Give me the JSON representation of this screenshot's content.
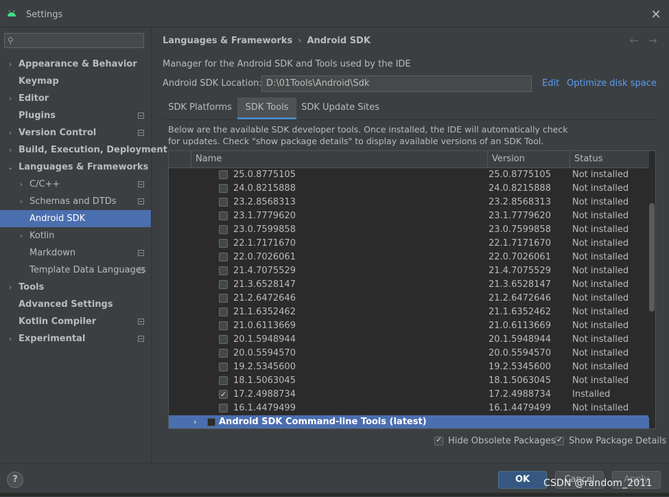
{
  "window": {
    "title": "Settings",
    "close_glyph": "✕"
  },
  "search": {
    "placeholder": ""
  },
  "sidebar": {
    "items": [
      {
        "label": "Appearance & Behavior",
        "chevron": "›",
        "bold": true,
        "indent": 0
      },
      {
        "label": "Keymap",
        "bold": true,
        "indent": 0
      },
      {
        "label": "Editor",
        "chevron": "›",
        "bold": true,
        "indent": 0
      },
      {
        "label": "Plugins",
        "bold": true,
        "indent": 0,
        "project": true
      },
      {
        "label": "Version Control",
        "chevron": "›",
        "bold": true,
        "indent": 0,
        "project": true
      },
      {
        "label": "Build, Execution, Deployment",
        "chevron": "›",
        "bold": true,
        "indent": 0
      },
      {
        "label": "Languages & Frameworks",
        "chevron": "⌄",
        "bold": true,
        "indent": 0
      },
      {
        "label": "C/C++",
        "chevron": "›",
        "indent": 1,
        "project": true
      },
      {
        "label": "Schemas and DTDs",
        "chevron": "›",
        "indent": 1,
        "project": true
      },
      {
        "label": "Android SDK",
        "indent": 1,
        "selected": true
      },
      {
        "label": "Kotlin",
        "chevron": "›",
        "indent": 1
      },
      {
        "label": "Markdown",
        "indent": 1,
        "project": true
      },
      {
        "label": "Template Data Languages",
        "indent": 1,
        "project": true
      },
      {
        "label": "Tools",
        "chevron": "›",
        "bold": true,
        "indent": 0
      },
      {
        "label": "Advanced Settings",
        "bold": true,
        "indent": 0
      },
      {
        "label": "Kotlin Compiler",
        "bold": true,
        "indent": 0,
        "project": true
      },
      {
        "label": "Experimental",
        "chevron": "›",
        "bold": true,
        "indent": 0,
        "project": true
      }
    ]
  },
  "breadcrumb": {
    "parent": "Languages & Frameworks",
    "separator": "›",
    "current": "Android SDK"
  },
  "nav": {
    "back": "←",
    "forward": "→"
  },
  "description": "Manager for the Android SDK and Tools used by the IDE",
  "sdk_location": {
    "label": "Android SDK Location:",
    "value": "D:\\01Tools\\Android\\Sdk",
    "edit": "Edit",
    "optimize": "Optimize disk space"
  },
  "tabs": [
    {
      "label": "SDK Platforms",
      "active": false
    },
    {
      "label": "SDK Tools",
      "active": true
    },
    {
      "label": "SDK Update Sites",
      "active": false
    }
  ],
  "panel_description": "Below are the available SDK developer tools. Once installed, the IDE will automatically check for updates. Check \"show package details\" to display available versions of an SDK Tool.",
  "table": {
    "columns": [
      "Name",
      "Version",
      "Status"
    ],
    "rows": [
      {
        "name": "25.0.8775105",
        "version": "25.0.8775105",
        "status": "Not installed",
        "checked": false
      },
      {
        "name": "24.0.8215888",
        "version": "24.0.8215888",
        "status": "Not installed",
        "checked": false
      },
      {
        "name": "23.2.8568313",
        "version": "23.2.8568313",
        "status": "Not installed",
        "checked": false
      },
      {
        "name": "23.1.7779620",
        "version": "23.1.7779620",
        "status": "Not installed",
        "checked": false
      },
      {
        "name": "23.0.7599858",
        "version": "23.0.7599858",
        "status": "Not installed",
        "checked": false
      },
      {
        "name": "22.1.7171670",
        "version": "22.1.7171670",
        "status": "Not installed",
        "checked": false
      },
      {
        "name": "22.0.7026061",
        "version": "22.0.7026061",
        "status": "Not installed",
        "checked": false
      },
      {
        "name": "21.4.7075529",
        "version": "21.4.7075529",
        "status": "Not installed",
        "checked": false
      },
      {
        "name": "21.3.6528147",
        "version": "21.3.6528147",
        "status": "Not installed",
        "checked": false
      },
      {
        "name": "21.2.6472646",
        "version": "21.2.6472646",
        "status": "Not installed",
        "checked": false
      },
      {
        "name": "21.1.6352462",
        "version": "21.1.6352462",
        "status": "Not installed",
        "checked": false
      },
      {
        "name": "21.0.6113669",
        "version": "21.0.6113669",
        "status": "Not installed",
        "checked": false
      },
      {
        "name": "20.1.5948944",
        "version": "20.1.5948944",
        "status": "Not installed",
        "checked": false
      },
      {
        "name": "20.0.5594570",
        "version": "20.0.5594570",
        "status": "Not installed",
        "checked": false
      },
      {
        "name": "19.2.5345600",
        "version": "19.2.5345600",
        "status": "Not installed",
        "checked": false
      },
      {
        "name": "18.1.5063045",
        "version": "18.1.5063045",
        "status": "Not installed",
        "checked": false
      },
      {
        "name": "17.2.4988734",
        "version": "17.2.4988734",
        "status": "Installed",
        "checked": true
      },
      {
        "name": "16.1.4479499",
        "version": "16.1.4479499",
        "status": "Not installed",
        "checked": false
      }
    ],
    "group_row": {
      "label": "Android SDK Command-line Tools (latest)",
      "chevron": "›"
    }
  },
  "options": {
    "hide_obsolete": "Hide Obsolete Packages",
    "show_details": "Show Package Details"
  },
  "footer": {
    "help": "?",
    "ok": "OK",
    "cancel": "Cancel",
    "apply": "Apply"
  },
  "watermark": "CSDN @random_2011",
  "colors": {
    "accent": "#4b6eaf",
    "link": "#589df6",
    "background": "#3c3f41",
    "table_bg": "#2b2b2b"
  }
}
